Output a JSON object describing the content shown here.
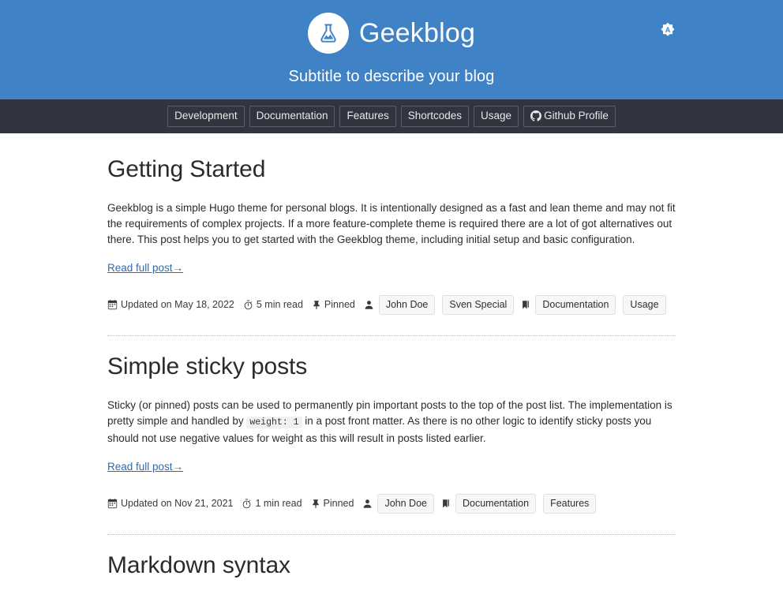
{
  "header": {
    "logo_icon": "flask-icon",
    "title": "Geekblog",
    "subtitle": "Subtitle to describe your blog",
    "theme_toggle_icon": "brightness-auto-icon",
    "theme_toggle_label": "A",
    "background_color": "#3f82c5"
  },
  "nav": {
    "background_color": "#32353f",
    "items": [
      {
        "label": "Development",
        "icon": null
      },
      {
        "label": "Documentation",
        "icon": null
      },
      {
        "label": "Features",
        "icon": null
      },
      {
        "label": "Shortcodes",
        "icon": null
      },
      {
        "label": "Usage",
        "icon": null
      },
      {
        "label": "Github Profile",
        "icon": "github-icon"
      }
    ]
  },
  "posts": [
    {
      "title": "Getting Started",
      "summary_part1": "Geekblog is a simple Hugo theme for personal blogs. It is intentionally designed as a fast and lean theme and may not fit the requirements of complex projects. If a more feature-complete theme is required there are a lot of got alternatives out there. This post helps you to get started with the Geekblog theme, including initial setup and basic configuration.",
      "read_more": "Read full post→",
      "meta": {
        "date_icon": "calendar-icon",
        "date": "Updated on May 18, 2022",
        "read_time_icon": "stopwatch-icon",
        "read_time": "5 min read",
        "pinned_icon": "pin-icon",
        "pinned": "Pinned",
        "author_icon": "person-icon",
        "authors": [
          "John Doe",
          "Sven Special"
        ],
        "tag_icon": "bookmark-icon",
        "tags": [
          "Documentation",
          "Usage"
        ]
      }
    },
    {
      "title": "Simple sticky posts",
      "summary_part1": "Sticky (or pinned) posts can be used to permanently pin important posts to the top of the post list. The implementation is pretty simple and handled by",
      "summary_code": "weight: 1",
      "summary_part2": "in a post front matter. As there is no other logic to identify sticky posts you should not use negative values for weight as this will result in posts listed earlier.",
      "read_more": "Read full post→",
      "meta": {
        "date_icon": "calendar-icon",
        "date": "Updated on Nov 21, 2021",
        "read_time_icon": "stopwatch-icon",
        "read_time": "1 min read",
        "pinned_icon": "pin-icon",
        "pinned": "Pinned",
        "author_icon": "person-icon",
        "authors": [
          "John Doe"
        ],
        "tag_icon": "bookmark-icon",
        "tags": [
          "Documentation",
          "Features"
        ]
      }
    },
    {
      "title": "Markdown syntax"
    }
  ],
  "colors": {
    "accent": "#3f82c5",
    "nav_bg": "#32353f",
    "link": "#2b6cb0",
    "text": "#2b2b2b",
    "badge_bg": "#f7f7f7",
    "divider": "#bdbdbd"
  }
}
